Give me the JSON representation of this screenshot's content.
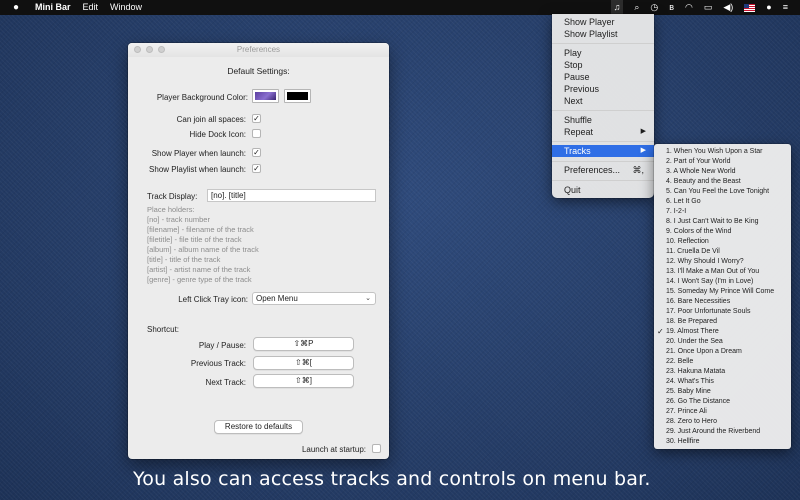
{
  "menubar": {
    "app_name": "Mini Bar",
    "menus": [
      "Edit",
      "Window"
    ],
    "status_glyphs": {
      "music": "♫",
      "search": "⌕",
      "time_machine": "◷",
      "bluetooth": "ʙ",
      "wifi": "◠",
      "airplay": "▭",
      "volume": "◀)",
      "user": "●",
      "list": "≡"
    }
  },
  "prefs": {
    "title": "Preferences",
    "heading": "Default Settings:",
    "bg_color_label": "Player Background Color:",
    "bg_colors": [
      "#5b3fa0",
      "#000000"
    ],
    "join_spaces_label": "Can join all spaces:",
    "join_spaces_checked": "✓",
    "hide_dock_label": "Hide Dock Icon:",
    "hide_dock_checked": "",
    "show_player_label": "Show Player when launch:",
    "show_player_checked": "✓",
    "show_playlist_label": "Show Playlist when launch:",
    "show_playlist_checked": "✓",
    "track_display_label": "Track Display:",
    "track_display_value": "[no]. [title]",
    "placeholders_title": "Place holders:",
    "placeholders": [
      "[no] - track number",
      "[filename] - filename of the track",
      "[filetitle] - file title of the track",
      "[album] - album name of the track",
      "[title] - title of the track",
      "[artist] - artist name of the track",
      "[genre] - genre type of the track"
    ],
    "left_click_label": "Left Click Tray icon:",
    "left_click_value": "Open Menu",
    "shortcut_heading": "Shortcut:",
    "play_pause_label": "Play / Pause:",
    "play_pause_value": "⇧⌘P",
    "previous_label": "Previous Track:",
    "previous_value": "⇧⌘[",
    "next_label": "Next Track:",
    "next_value": "⇧⌘]",
    "restore_label": "Restore to defaults",
    "launch_label": "Launch at startup:",
    "launch_checked": ""
  },
  "menu": {
    "show_player": "Show Player",
    "show_playlist": "Show Playlist",
    "play": "Play",
    "stop": "Stop",
    "pause": "Pause",
    "previous": "Previous",
    "next": "Next",
    "shuffle": "Shuffle",
    "repeat": "Repeat",
    "tracks": "Tracks",
    "preferences": "Preferences...",
    "preferences_shortcut": "⌘,",
    "quit": "Quit",
    "highlight_color": "#2f6ee6"
  },
  "tracks": [
    "1. When You Wish Upon a Star",
    "2. Part of Your World",
    "3. A Whole New World",
    "4. Beauty and the Beast",
    "5. Can You Feel the Love Tonight",
    "6. Let It Go",
    "7. I-2-I",
    "8. I Just Can't Wait to Be King",
    "9. Colors of the Wind",
    "10. Reflection",
    "11. Cruella De Vil",
    "12. Why Should I Worry?",
    "13. I'll Make a Man Out of You",
    "14. I Won't Say (I'm in Love)",
    "15. Someday My Prince Will Come",
    "16. Bare Necessities",
    "17. Poor Unfortunate Souls",
    "18. Be Prepared",
    "19. Almost There",
    "20. Under the Sea",
    "21. Once Upon a Dream",
    "22. Belle",
    "23. Hakuna Matata",
    "24. What's This",
    "25. Baby Mine",
    "26. Go The Distance",
    "27. Prince Ali",
    "28. Zero to Hero",
    "29. Just Around the Riverbend",
    "30. Hellfire"
  ],
  "checked_track_index": 18,
  "checkmark": "✓",
  "caption": "You also can access tracks and controls on menu bar."
}
